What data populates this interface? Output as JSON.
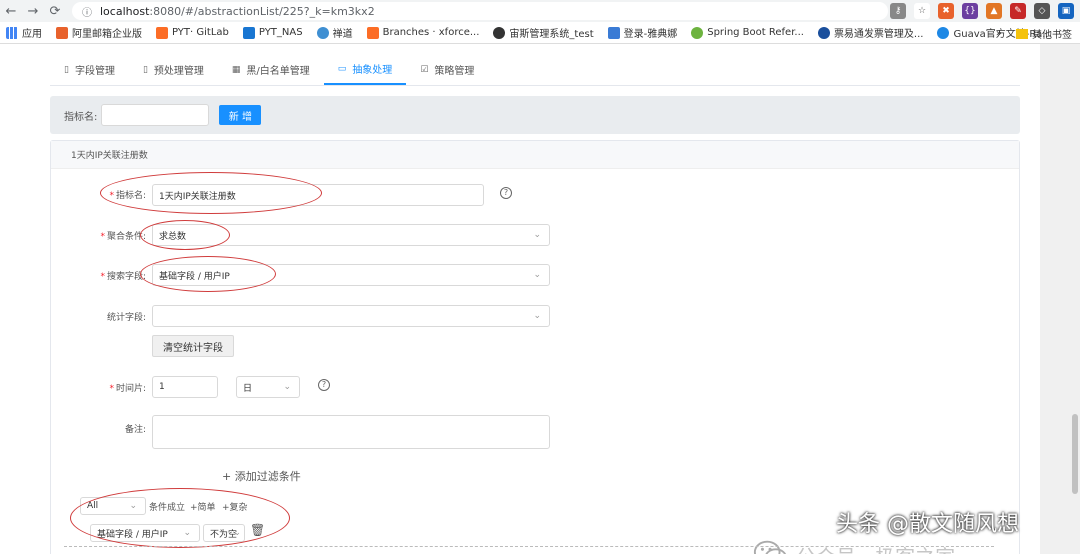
{
  "browser": {
    "url_host": "localhost",
    "url_rest": ":8080/#/abstractionList/225?_k=km3kx2",
    "bookmarks": [
      "应用",
      "阿里邮箱企业版",
      "PYT· GitLab",
      "PYT_NAS",
      "禅道",
      "Branches · xforce...",
      "宙斯管理系统_test",
      "登录-雅典娜",
      "Spring Boot Refer...",
      "票易通发票管理及...",
      "Guava官方文档-Ra..."
    ],
    "bookmarks_more": "»",
    "other_bookmarks": "其他书签"
  },
  "tabs": [
    {
      "label": "字段管理",
      "icon": "file-icon"
    },
    {
      "label": "预处理管理",
      "icon": "file-icon"
    },
    {
      "label": "黑/白名单管理",
      "icon": "grid-icon"
    },
    {
      "label": "抽象处理",
      "icon": "edit-icon",
      "active": true
    },
    {
      "label": "策略管理",
      "icon": "edit-icon"
    }
  ],
  "search": {
    "label": "指标名:",
    "button": "新 增"
  },
  "card": {
    "title": "1天内IP关联注册数"
  },
  "form": {
    "name_label": "指标名:",
    "name_value": "1天内IP关联注册数",
    "agg_label": "聚合条件:",
    "agg_value": "求总数",
    "search_field_label": "搜索字段:",
    "search_field_value": "基础字段 / 用户IP",
    "stat_field_label": "统计字段:",
    "clear_button": "清空统计字段",
    "time_label": "时间片:",
    "time_value": "1",
    "time_unit": "日",
    "remark_label": "备注:",
    "add_filter": "+ 添加过滤条件",
    "filter_all": "All",
    "filter_condition_text": "条件成立",
    "filter_simple": "+简单",
    "filter_complex": "+复杂",
    "filter_field": "基础字段 / 用户IP",
    "filter_op": "不为空"
  },
  "watermark": {
    "platform": "公众号 · 极客之家",
    "author": "头条 @散文随风想"
  }
}
